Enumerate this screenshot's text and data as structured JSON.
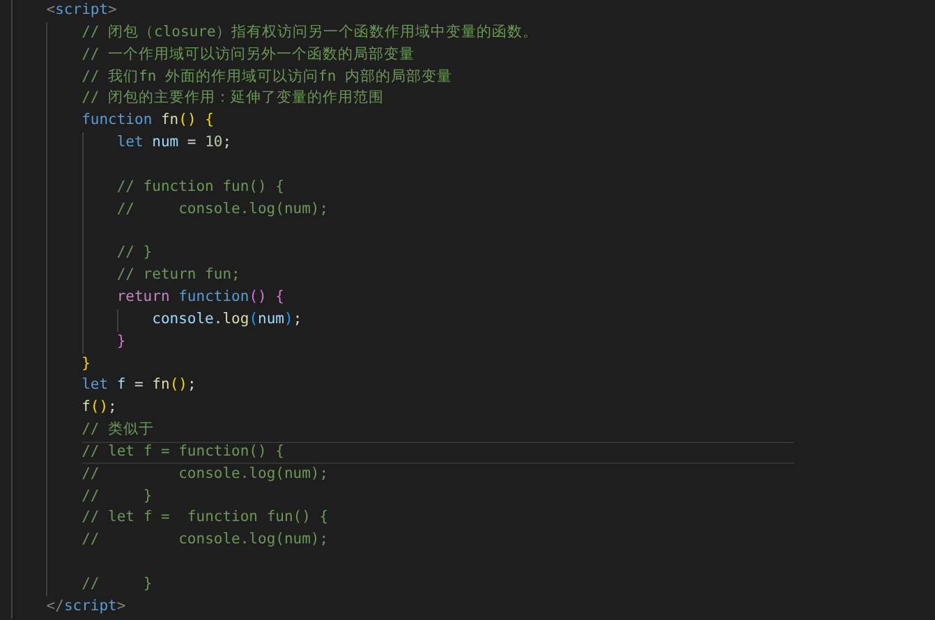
{
  "editor": {
    "lines": [
      {
        "tokens": [
          {
            "kind": "tag-bracket",
            "text": "<"
          },
          {
            "kind": "tag",
            "text": "script"
          },
          {
            "kind": "tag-bracket",
            "text": ">"
          }
        ],
        "children": [
          {
            "tokens": [
              {
                "kind": "comment",
                "text": "// 闭包（closure）指有权访问另一个函数作用域中变量的函数。"
              }
            ]
          },
          {
            "tokens": [
              {
                "kind": "comment",
                "text": "// 一个作用域可以访问另外一个函数的局部变量"
              }
            ]
          },
          {
            "tokens": [
              {
                "kind": "comment",
                "text": "// 我们fn 外面的作用域可以访问fn 内部的局部变量"
              }
            ]
          },
          {
            "tokens": [
              {
                "kind": "comment",
                "text": "// 闭包的主要作用：延伸了变量的作用范围"
              }
            ]
          },
          {
            "tokens": [
              {
                "kind": "keyword",
                "text": "function "
              },
              {
                "kind": "function",
                "text": "fn"
              },
              {
                "kind": "bracket-1",
                "text": "() {"
              }
            ],
            "children": [
              {
                "tokens": [
                  {
                    "kind": "keyword",
                    "text": "let "
                  },
                  {
                    "kind": "variable",
                    "text": "num"
                  },
                  {
                    "kind": "plain",
                    "text": " = "
                  },
                  {
                    "kind": "number",
                    "text": "10"
                  },
                  {
                    "kind": "plain",
                    "text": ";"
                  }
                ]
              },
              {
                "kind": "blank"
              },
              {
                "tokens": [
                  {
                    "kind": "comment",
                    "text": "// function fun() {"
                  }
                ]
              },
              {
                "tokens": [
                  {
                    "kind": "comment",
                    "text": "//     console.log(num);"
                  }
                ]
              },
              {
                "kind": "blank"
              },
              {
                "tokens": [
                  {
                    "kind": "comment",
                    "text": "// }"
                  }
                ]
              },
              {
                "tokens": [
                  {
                    "kind": "comment",
                    "text": "// return fun;"
                  }
                ]
              },
              {
                "tokens": [
                  {
                    "kind": "control",
                    "text": "return "
                  },
                  {
                    "kind": "keyword",
                    "text": "function"
                  },
                  {
                    "kind": "bracket-2",
                    "text": "() {"
                  }
                ],
                "children": [
                  {
                    "tokens": [
                      {
                        "kind": "variable",
                        "text": "console"
                      },
                      {
                        "kind": "plain",
                        "text": "."
                      },
                      {
                        "kind": "function",
                        "text": "log"
                      },
                      {
                        "kind": "bracket-3",
                        "text": "("
                      },
                      {
                        "kind": "variable",
                        "text": "num"
                      },
                      {
                        "kind": "bracket-3",
                        "text": ")"
                      },
                      {
                        "kind": "plain",
                        "text": ";"
                      }
                    ]
                  }
                ]
              },
              {
                "tokens": [
                  {
                    "kind": "bracket-2",
                    "text": "}"
                  }
                ]
              }
            ]
          },
          {
            "tokens": [
              {
                "kind": "bracket-1",
                "text": "}"
              }
            ]
          },
          {
            "tokens": [
              {
                "kind": "keyword",
                "text": "let "
              },
              {
                "kind": "variable",
                "text": "f"
              },
              {
                "kind": "plain",
                "text": " = "
              },
              {
                "kind": "function",
                "text": "fn"
              },
              {
                "kind": "bracket-1",
                "text": "()"
              },
              {
                "kind": "plain",
                "text": ";"
              }
            ]
          },
          {
            "tokens": [
              {
                "kind": "function",
                "text": "f"
              },
              {
                "kind": "bracket-1",
                "text": "()"
              },
              {
                "kind": "plain",
                "text": ";"
              }
            ]
          },
          {
            "tokens": [
              {
                "kind": "comment",
                "text": "// 类似于"
              }
            ]
          },
          {
            "highlighted": true,
            "tokens": [
              {
                "kind": "comment",
                "text": "// let f = function() {"
              }
            ]
          },
          {
            "tokens": [
              {
                "kind": "comment",
                "text": "//         console.log(num);"
              }
            ]
          },
          {
            "tokens": [
              {
                "kind": "comment",
                "text": "//     }"
              }
            ]
          },
          {
            "tokens": [
              {
                "kind": "comment",
                "text": "// let f =  function fun() {"
              }
            ]
          },
          {
            "tokens": [
              {
                "kind": "comment",
                "text": "//         console.log(num);"
              }
            ]
          },
          {
            "kind": "blank"
          },
          {
            "tokens": [
              {
                "kind": "comment",
                "text": "//     }"
              }
            ]
          }
        ]
      },
      {
        "tokens": [
          {
            "kind": "tag-bracket",
            "text": "</"
          },
          {
            "kind": "tag",
            "text": "script"
          },
          {
            "kind": "tag-bracket",
            "text": ">"
          }
        ]
      }
    ]
  }
}
